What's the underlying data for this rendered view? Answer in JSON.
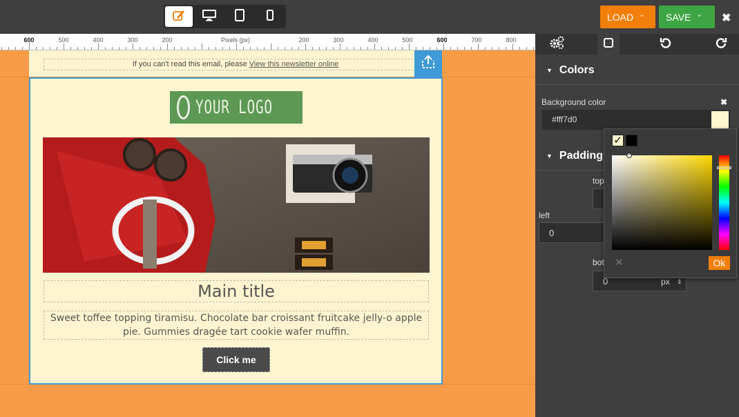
{
  "toolbar": {
    "devices": [
      {
        "name": "edit",
        "icon": "pencil-icon",
        "active": true
      },
      {
        "name": "desktop",
        "icon": "desktop-icon",
        "active": false
      },
      {
        "name": "tablet",
        "icon": "tablet-icon",
        "active": false
      },
      {
        "name": "mobile",
        "icon": "mobile-icon",
        "active": false
      }
    ],
    "load_label": "LOAD",
    "save_label": "SAVE",
    "close_label": "✖",
    "chevron": "⌄"
  },
  "ruler": {
    "unit_label": "Pixels (px)",
    "left_labels": [
      "600",
      "500",
      "400",
      "300",
      "200"
    ],
    "right_labels": [
      "200",
      "300",
      "400",
      "500",
      "600",
      "700",
      "800"
    ]
  },
  "email": {
    "preheader_text": "If you can't read this email, please ",
    "preheader_link": "View this newsletter online",
    "logo_text": "YOUR LOGO",
    "main_title": "Main title",
    "body_text": "Sweet toffee topping tiramisu. Chocolate bar croissant fruitcake jelly-o apple pie. Gummies dragée tart cookie wafer muffin.",
    "cta_label": "Click me",
    "colors": {
      "canvas": "#f89c48",
      "block": "#fef5d0",
      "logo_bg": "#5d9854",
      "selection": "#3e9ad6"
    }
  },
  "panel": {
    "tabs": [
      {
        "icon": "gears-icon"
      },
      {
        "icon": "square-icon"
      },
      {
        "icon": "undo-icon"
      },
      {
        "icon": "redo-icon"
      }
    ],
    "colors_section": {
      "title": "Colors",
      "background_label": "Background color",
      "background_value": "#fff7d0",
      "clear_label": "✖"
    },
    "padding_section": {
      "title": "Padding",
      "top_label": "top",
      "left_label": "left",
      "left_value": "0",
      "bottom_label": "bot",
      "bottom_value": "0",
      "unit": "px"
    }
  },
  "picker": {
    "ok_label": "Ok",
    "cancel_label": "✕",
    "hue_color": "#ffd800"
  }
}
